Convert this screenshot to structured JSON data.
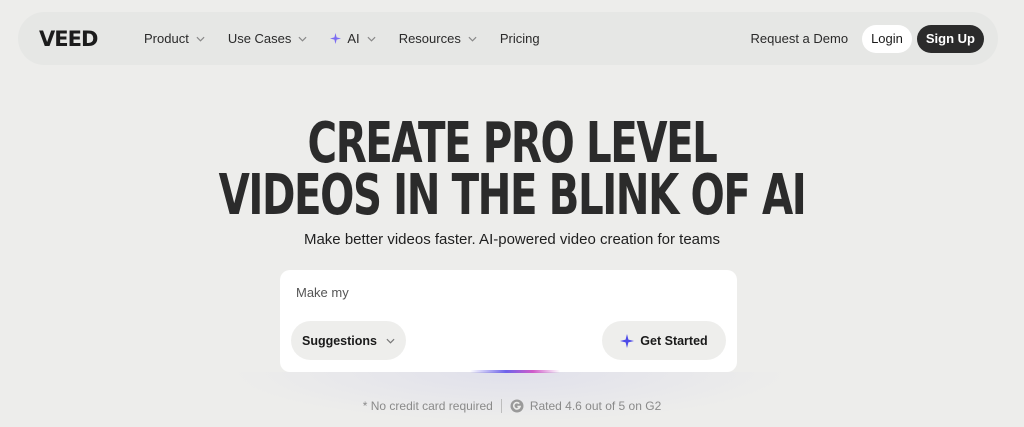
{
  "nav": {
    "logo": "VEED",
    "items": [
      {
        "label": "Product",
        "has_dropdown": true
      },
      {
        "label": "Use Cases",
        "has_dropdown": true
      },
      {
        "label": "AI",
        "has_dropdown": true,
        "icon": "sparkle-icon"
      },
      {
        "label": "Resources",
        "has_dropdown": true
      },
      {
        "label": "Pricing",
        "has_dropdown": false
      }
    ],
    "request_demo": "Request a Demo",
    "login": "Login",
    "signup": "Sign Up"
  },
  "hero": {
    "title_line1": "CREATE PRO LEVEL",
    "title_line2": "VIDEOS IN THE BLINK OF AI",
    "subtitle": "Make better videos faster. AI-powered video creation for teams"
  },
  "prompt": {
    "placeholder": "Make my",
    "suggestions_label": "Suggestions",
    "get_started_label": "Get Started"
  },
  "trust": {
    "no_card": "* No credit card required",
    "rating": "Rated 4.6 out of 5 on G2"
  },
  "colors": {
    "background": "#ededeb",
    "nav_bg": "#e6e7e5",
    "accent": "#5b5cf0",
    "dark_button": "#2b2b2b"
  }
}
